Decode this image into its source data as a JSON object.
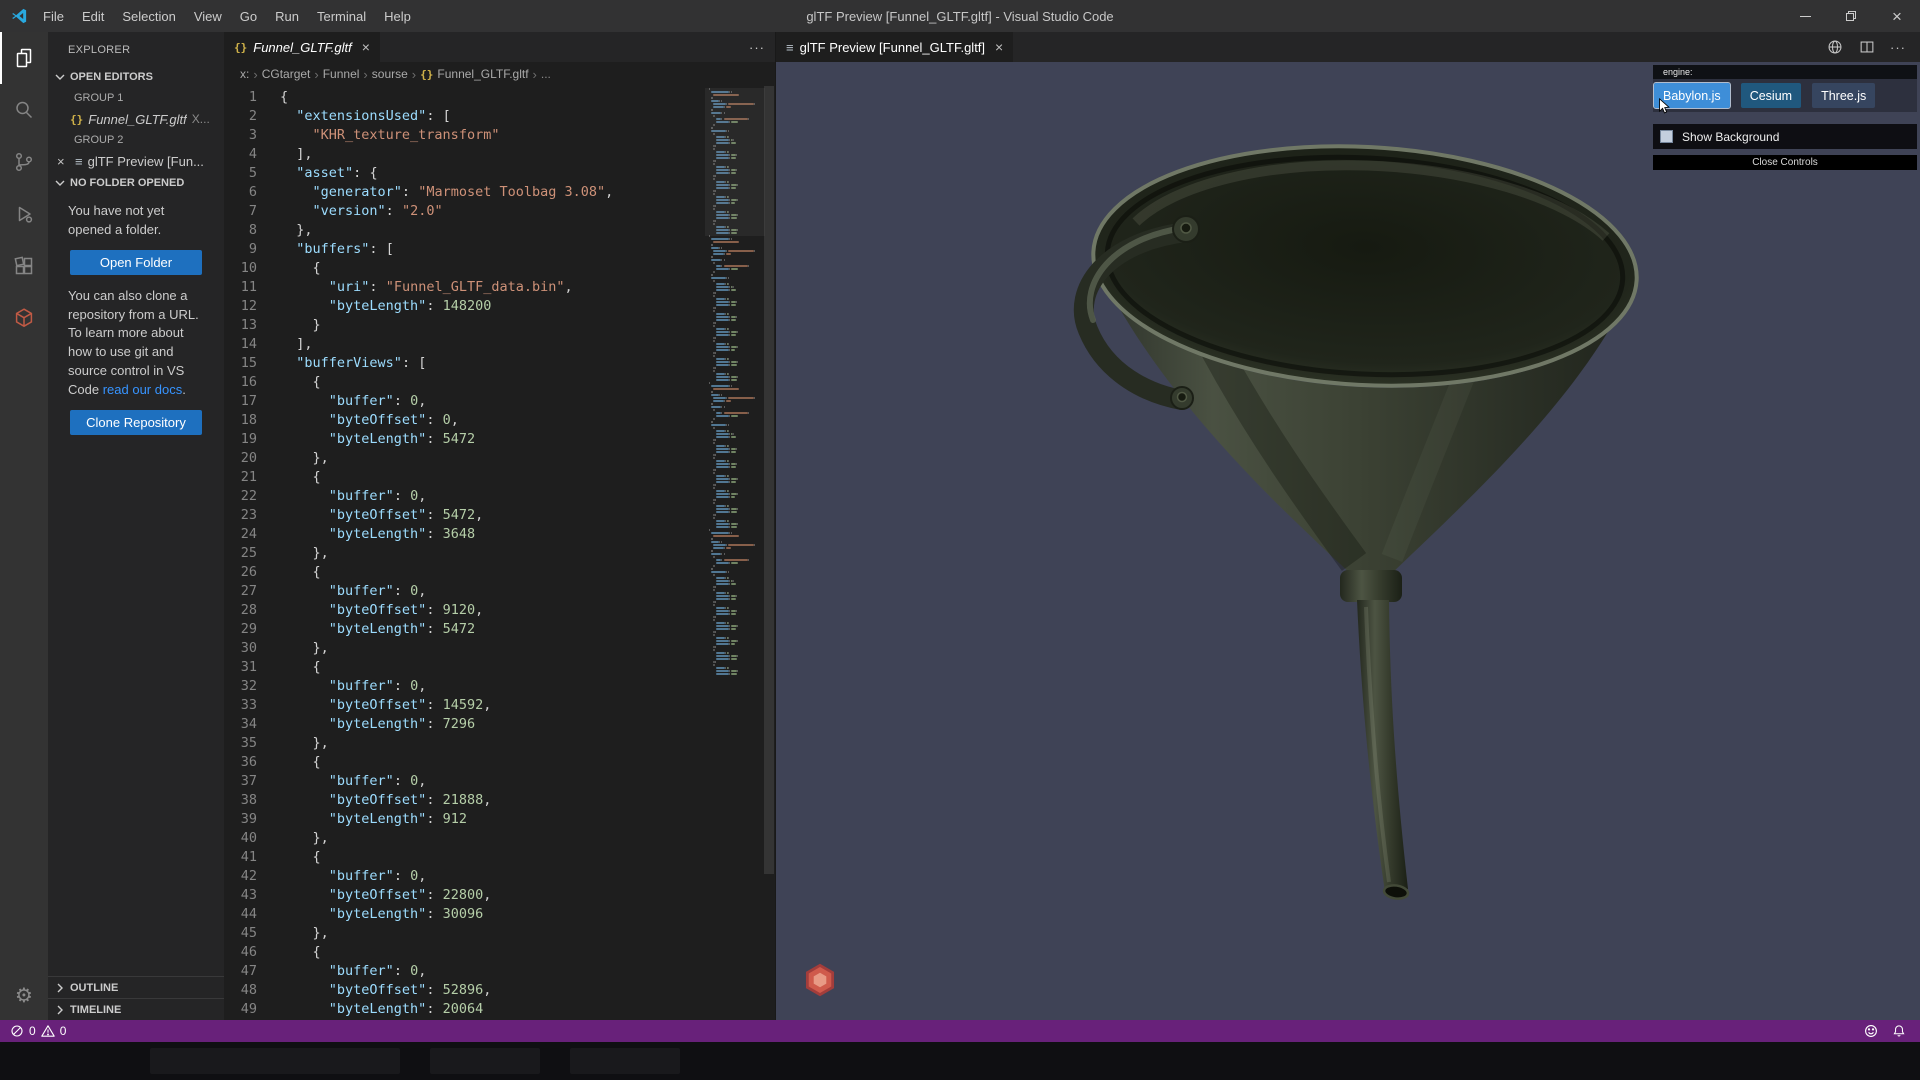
{
  "titlebar": {
    "title": "glTF Preview [Funnel_GLTF.gltf] - Visual Studio Code",
    "menus": [
      "File",
      "Edit",
      "Selection",
      "View",
      "Go",
      "Run",
      "Terminal",
      "Help"
    ]
  },
  "icons": {
    "close": "×",
    "more": "···",
    "preview": "≡",
    "braces": "{}",
    "gear": "⚙",
    "crumb_sep": "›"
  },
  "sidebar": {
    "title": "EXPLORER",
    "open_editors_label": "OPEN EDITORS",
    "group1_label": "GROUP 1",
    "group1_item_name": "Funnel_GLTF.gltf",
    "group1_item_detail": "X...",
    "group2_label": "GROUP 2",
    "group2_item_name": "glTF Preview [Fun...",
    "no_folder_label": "NO FOLDER OPENED",
    "no_folder_text": "You have not yet opened a folder.",
    "open_folder_button": "Open Folder",
    "clone_text_before": "You can also clone a repository from a URL. To learn more about how to use git and source control in VS Code ",
    "clone_link": "read our docs",
    "clone_text_after": ".",
    "clone_button": "Clone Repository",
    "outline_label": "OUTLINE",
    "timeline_label": "TIMELINE"
  },
  "editor": {
    "tab_name": "Funnel_GLTF.gltf",
    "breadcrumbs": [
      "x:",
      "CGtarget",
      "Funnel",
      "sourse"
    ],
    "breadcrumb_file": "Funnel_GLTF.gltf",
    "breadcrumb_tail": "...",
    "code_lines": [
      "{",
      "  \"extensionsUsed\": [",
      "    \"KHR_texture_transform\"",
      "  ],",
      "  \"asset\": {",
      "    \"generator\": \"Marmoset Toolbag 3.08\",",
      "    \"version\": \"2.0\"",
      "  },",
      "  \"buffers\": [",
      "    {",
      "      \"uri\": \"Funnel_GLTF_data.bin\",",
      "      \"byteLength\": 148200",
      "    }",
      "  ],",
      "  \"bufferViews\": [",
      "    {",
      "      \"buffer\": 0,",
      "      \"byteOffset\": 0,",
      "      \"byteLength\": 5472",
      "    },",
      "    {",
      "      \"buffer\": 0,",
      "      \"byteOffset\": 5472,",
      "      \"byteLength\": 3648",
      "    },",
      "    {",
      "      \"buffer\": 0,",
      "      \"byteOffset\": 9120,",
      "      \"byteLength\": 5472",
      "    },",
      "    {",
      "      \"buffer\": 0,",
      "      \"byteOffset\": 14592,",
      "      \"byteLength\": 7296",
      "    },",
      "    {",
      "      \"buffer\": 0,",
      "      \"byteOffset\": 21888,",
      "      \"byteLength\": 912",
      "    },",
      "    {",
      "      \"buffer\": 0,",
      "      \"byteOffset\": 22800,",
      "      \"byteLength\": 30096",
      "    },",
      "    {",
      "      \"buffer\": 0,",
      "      \"byteOffset\": 52896,",
      "      \"byteLength\": 20064"
    ]
  },
  "preview": {
    "tab_name": "glTF Preview [Funnel_GLTF.gltf]",
    "engine_label": "engine:",
    "engines": [
      {
        "label": "Babylon.js",
        "active": true,
        "color": "#3e8ed8"
      },
      {
        "label": "Cesium",
        "active": false,
        "color": "#20587e"
      },
      {
        "label": "Three.js",
        "active": false,
        "color": "#36455f"
      }
    ],
    "show_background_label": "Show Background",
    "show_background_checked": false,
    "close_controls_label": "Close Controls",
    "background_color": "#3f4356"
  },
  "status_bar": {
    "errors": "0",
    "warnings": "0"
  }
}
